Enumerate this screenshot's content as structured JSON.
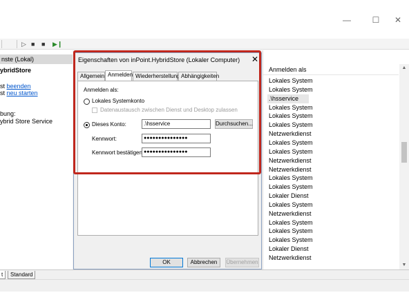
{
  "window": {
    "controls": {
      "minimize": "—",
      "maximize": "☐",
      "close": "✕"
    }
  },
  "toolbar": {
    "play": "▷",
    "pause": "■",
    "stop": "■",
    "restart": "▶❙"
  },
  "left_pane": {
    "header": "nste (Lokal)",
    "service_name": "ybridStore",
    "line1_prefix": "st ",
    "line1_link": "beenden",
    "line2_prefix": "st ",
    "line2_link": "neu starten",
    "desc_label": "bung:",
    "desc_value": "ybrid Store Service"
  },
  "right_pane": {
    "header": "Anmelden als",
    "rows": [
      "Lokales System",
      "Lokales System",
      ".\\hsservice",
      "Lokales System",
      "Lokales System",
      "Lokales System",
      "Netzwerkdienst",
      "Lokales System",
      "Lokales System",
      "Netzwerkdienst",
      "Netzwerkdienst",
      "Lokales System",
      "Lokales System",
      "Lokaler Dienst",
      "Lokales System",
      "Netzwerkdienst",
      "Lokales System",
      "Lokales System",
      "Lokales System",
      "Lokaler Dienst",
      "Netzwerkdienst"
    ],
    "selected_index": 2
  },
  "bottom_tabs": {
    "extended": "t",
    "standard": "Standard"
  },
  "dialog": {
    "title": "Eigenschaften von inPoint.HybridStore (Lokaler Computer)",
    "close": "✕",
    "tabs": [
      "Allgemein",
      "Anmelden",
      "Wiederherstellung",
      "Abhängigkeiten"
    ],
    "active_tab": 1,
    "logon_as_label": "Anmelden als:",
    "local_system_label": "Lokales Systemkonto",
    "desktop_interact_label": "Datenaustausch zwischen Dienst und Desktop zulassen",
    "this_account_label": "Dieses Konto:",
    "account_value": ".\\hsservice",
    "browse_label": "Durchsuchen...",
    "password_label": "Kennwort:",
    "password_value": "●●●●●●●●●●●●●●●",
    "confirm_label": "Kennwort bestätigen:",
    "confirm_value": "●●●●●●●●●●●●●●●",
    "ok_label": "OK",
    "cancel_label": "Abbrechen",
    "apply_label": "Übernehmen"
  },
  "colors": {
    "highlight": "#c0271d",
    "link": "#0055cc",
    "dialog_border": "#8aa0c0"
  }
}
